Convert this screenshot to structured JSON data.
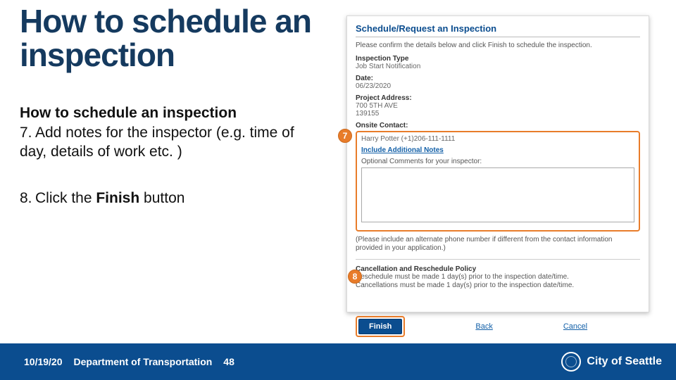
{
  "title": "How to schedule an inspection",
  "subhead": "How to schedule an inspection",
  "steps": {
    "seven_num": "7.",
    "seven_txt": "Add notes for the inspector (e.g. time of day, details of work etc. )",
    "eight_num": "8.",
    "eight_txt_pre": "Click the ",
    "eight_txt_bold": "Finish",
    "eight_txt_post": " button"
  },
  "callouts": {
    "seven": "7",
    "eight": "8"
  },
  "footer": {
    "date": "10/19/20",
    "dept": "Department of Transportation",
    "page": "48",
    "city_pre": "City of ",
    "city_bold": "Seattle"
  },
  "shot": {
    "panel_title": "Schedule/Request an Inspection",
    "confirm": "Please confirm the details below and click Finish to schedule the inspection.",
    "insp_type_lbl": "Inspection Type",
    "insp_type_val": "Job Start Notification",
    "date_lbl": "Date:",
    "date_val": "06/23/2020",
    "addr_lbl": "Project Address:",
    "addr_val1": "700 5TH AVE",
    "addr_val2": "139155",
    "contact_lbl": "Onsite Contact:",
    "contact_val": "Harry Potter (+1)206-111-1111",
    "notes_link": "Include Additional Notes",
    "notes_opt": "Optional Comments for your inspector:",
    "alt_phone": "(Please include an alternate phone number if different from the contact information provided in your application.)",
    "policy_lbl": "Cancellation and Reschedule Policy",
    "policy1": "Reschedule must be made 1 day(s) prior to the inspection date/time.",
    "policy2": "Cancellations must be made 1 day(s) prior to the inspection date/time.",
    "finish": "Finish",
    "back": "Back",
    "cancel": "Cancel"
  }
}
